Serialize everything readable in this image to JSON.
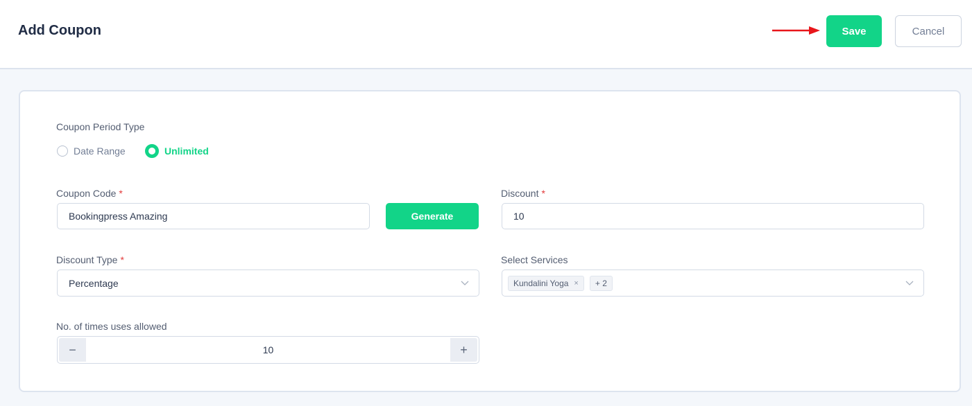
{
  "header": {
    "title": "Add Coupon",
    "save_label": "Save",
    "cancel_label": "Cancel"
  },
  "form": {
    "period_type": {
      "label": "Coupon Period Type",
      "options": [
        {
          "label": "Date Range",
          "checked": false
        },
        {
          "label": "Unlimited",
          "checked": true
        }
      ]
    },
    "coupon_code": {
      "label": "Coupon Code",
      "required_mark": "*",
      "value": "Bookingpress Amazing",
      "generate_label": "Generate"
    },
    "discount": {
      "label": "Discount",
      "required_mark": "*",
      "value": "10"
    },
    "discount_type": {
      "label": "Discount Type",
      "required_mark": "*",
      "value": "Percentage"
    },
    "select_services": {
      "label": "Select Services",
      "tags": [
        {
          "label": "Kundalini Yoga",
          "remove": "×"
        },
        {
          "label": "+ 2"
        }
      ]
    },
    "uses_allowed": {
      "label": "No. of times uses allowed",
      "value": "10",
      "minus": "−",
      "plus": "+"
    }
  },
  "colors": {
    "accent": "#12d488",
    "arrow": "#e8161b",
    "required": "#e23b3b"
  }
}
